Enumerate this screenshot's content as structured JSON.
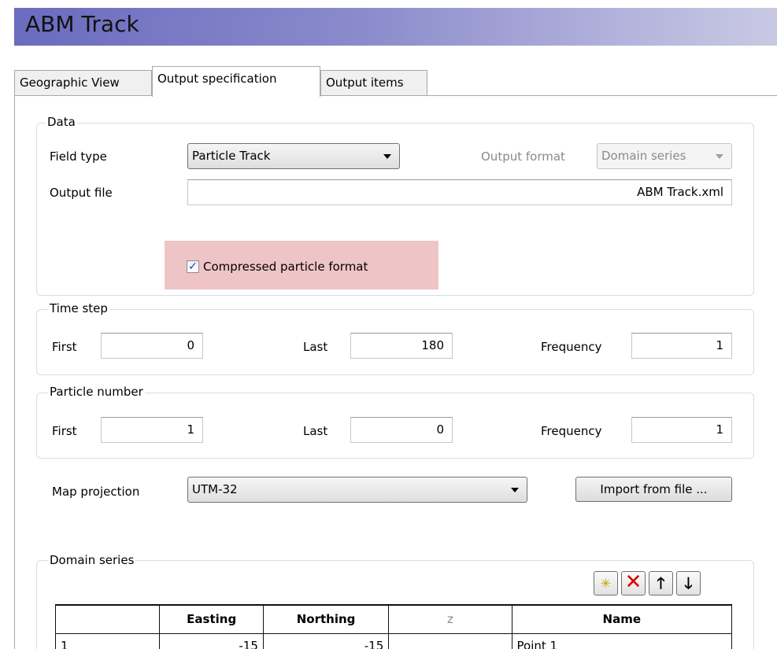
{
  "window": {
    "title": "ABM Track"
  },
  "tabs": [
    {
      "label": "Geographic View"
    },
    {
      "label": "Output specification"
    },
    {
      "label": "Output items"
    }
  ],
  "data_group": {
    "label": "Data",
    "field_type_label": "Field type",
    "field_type_value": "Particle Track",
    "output_format_label": "Output format",
    "output_format_value": "Domain series",
    "output_file_label": "Output file",
    "output_file_value": "ABM Track.xml",
    "compressed_label": "Compressed particle format",
    "compressed_checked": true,
    "check_glyph": "✓"
  },
  "time_step": {
    "label": "Time step",
    "first_label": "First",
    "first_value": "0",
    "last_label": "Last",
    "last_value": "180",
    "frequency_label": "Frequency",
    "frequency_value": "1"
  },
  "particle_number": {
    "label": "Particle number",
    "first_label": "First",
    "first_value": "1",
    "last_label": "Last",
    "last_value": "0",
    "frequency_label": "Frequency",
    "frequency_value": "1"
  },
  "map_projection": {
    "label": "Map projection",
    "value": "UTM-32",
    "import_button": "Import from file ..."
  },
  "domain_series": {
    "label": "Domain series",
    "toolbar": {
      "new_icon": "new-item-icon",
      "delete_icon": "delete-icon",
      "up_icon": "arrow-up-icon",
      "down_icon": "arrow-down-icon"
    },
    "columns": [
      "",
      "Easting",
      "Northing",
      "z",
      "Name"
    ],
    "rows": [
      {
        "id": "1",
        "easting": "-15",
        "northing": "-15",
        "z": "",
        "name": "Point 1"
      }
    ]
  },
  "colors": {
    "highlight": "#efc4c6",
    "title_gradient_start": "#6b6bbf"
  }
}
